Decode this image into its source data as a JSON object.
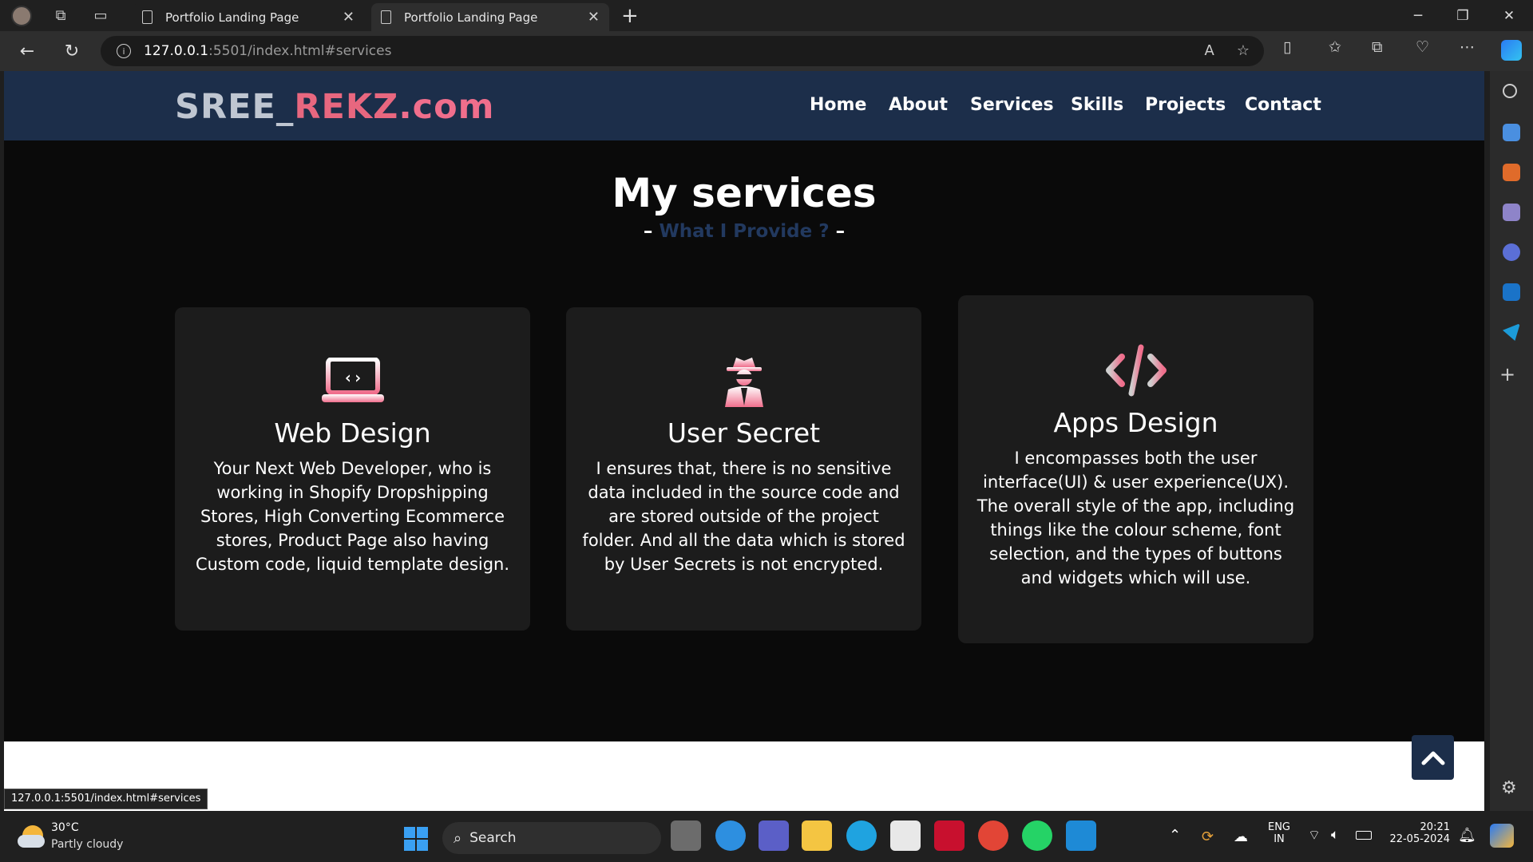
{
  "browser": {
    "tabs": [
      {
        "title": "Portfolio Landing Page",
        "active": false
      },
      {
        "title": "Portfolio Landing Page",
        "active": true
      }
    ],
    "url_host": "127.0.0.1",
    "url_path": ":5501/index.html#services",
    "status_url": "127.0.0.1:5501/index.html#services"
  },
  "site": {
    "logo_part1": "SREE_",
    "logo_part2": "REKZ",
    "logo_part3": ".com",
    "nav": [
      "Home",
      "About",
      "Services",
      "Skills",
      "Projects",
      "Contact"
    ],
    "section_title": "My services",
    "section_sub_prefix": "– ",
    "section_sub_highlight": "What I Provide ?",
    "section_sub_suffix": " –",
    "cards": [
      {
        "icon": "laptop-code-icon",
        "title": "Web Design",
        "text": "Your Next Web Developer, who is working in Shopify Dropshipping Stores, High Converting Ecommerce stores, Product Page also having Custom code, liquid template design."
      },
      {
        "icon": "user-secret-icon",
        "title": "User Secret",
        "text": "I ensures that, there is no sensitive data included in the source code and are stored outside of the project folder. And all the data which is stored by User Secrets is not encrypted."
      },
      {
        "icon": "code-icon",
        "title": "Apps Design",
        "text": "I encompasses both the user interface(UI) & user experience(UX). The overall style of the app, including things like the colour scheme, font selection, and the types of buttons and widgets which will use."
      }
    ]
  },
  "taskbar": {
    "weather_temp": "30°C",
    "weather_desc": "Partly cloudy",
    "search_label": "Search",
    "lang_line1": "ENG",
    "lang_line2": "IN",
    "time": "20:21",
    "date": "22-05-2024"
  },
  "colors": {
    "header_bg": "#1c2e4a",
    "accent_pink": "#f06e8c",
    "card_bg": "#1c1c1c"
  }
}
